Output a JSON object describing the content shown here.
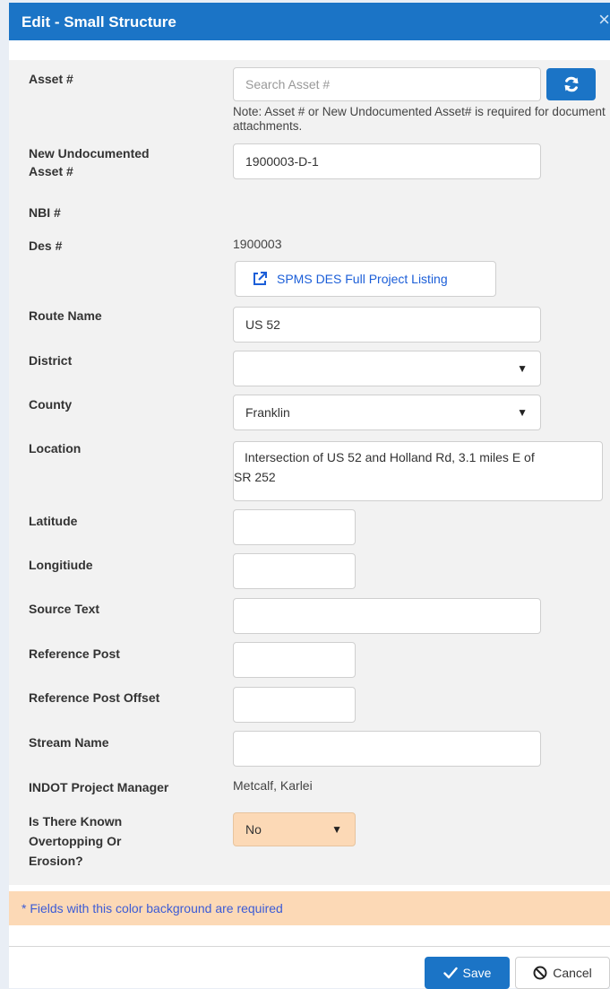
{
  "dialog": {
    "title": "Edit - Small Structure",
    "close_glyph": "×"
  },
  "fields": {
    "asset": {
      "label": "Asset #",
      "placeholder": "Search Asset #",
      "note": "Note: Asset # or New Undocumented Asset# is required for document attachments."
    },
    "new_undocumented": {
      "label_line1": "New Undocumented",
      "label_line2": "Asset #",
      "value": "1900003-D-1"
    },
    "nbi": {
      "label": "NBI #"
    },
    "des": {
      "label": "Des #",
      "value": "1900003",
      "button_label": "SPMS DES Full Project Listing"
    },
    "route_name": {
      "label": "Route Name",
      "value": "US 52"
    },
    "district": {
      "label": "District",
      "value": ""
    },
    "county": {
      "label": "County",
      "value": "Franklin"
    },
    "location": {
      "label": "Location",
      "value_line1": "Intersection of US 52 and Holland Rd, 3.1 miles E of",
      "value_line2": "SR 252"
    },
    "latitude": {
      "label": "Latitude",
      "value": ""
    },
    "longitude": {
      "label": "Longitiude",
      "value": ""
    },
    "source_text": {
      "label": "Source Text",
      "value": ""
    },
    "reference_post": {
      "label": "Reference Post",
      "value": ""
    },
    "reference_post_offset": {
      "label": "Reference Post Offset",
      "value": ""
    },
    "stream_name": {
      "label": "Stream Name",
      "value": ""
    },
    "project_manager": {
      "label": "INDOT Project Manager",
      "value": "Metcalf, Karlei"
    },
    "overtopping": {
      "label_line1": "Is There Known",
      "label_line2": "Overtopping Or",
      "label_line3": "Erosion?",
      "value": "No"
    }
  },
  "required_note": "* Fields with this color background are required",
  "buttons": {
    "save": "Save",
    "cancel": "Cancel"
  },
  "colors": {
    "header": "#1b74c6",
    "required_bg": "#fcd9b6",
    "link": "#1b5ed8"
  }
}
